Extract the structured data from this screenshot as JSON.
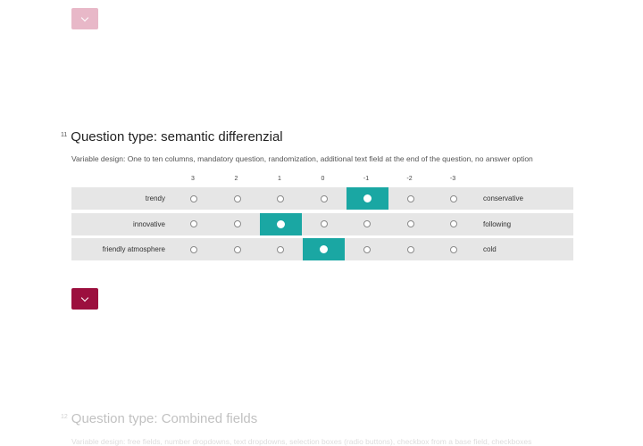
{
  "prev_question": {
    "next_icon": "chevron-down-icon"
  },
  "question": {
    "number": "11",
    "title": "Question type: semantic differenzial",
    "description": "Variable design: One to ten columns, mandatory question, randomization, additional text field at the end of the question, no answer option",
    "scale": [
      "3",
      "2",
      "1",
      "0",
      "-1",
      "-2",
      "-3"
    ],
    "rows": [
      {
        "left": "trendy",
        "right": "conservative",
        "selected": "-1"
      },
      {
        "left": "innovative",
        "right": "following",
        "selected": "1"
      },
      {
        "left": "friendly atmosphere",
        "right": "cold",
        "selected": "0"
      }
    ],
    "next_icon": "chevron-down-icon"
  },
  "next_question": {
    "number": "12",
    "title": "Question type: Combined fields",
    "description": "Variable design: free fields, number dropdowns, text dropdowns, selection boxes (radio buttons), checkbox from a base field, checkboxes"
  },
  "colors": {
    "accent": "#9c0f3e",
    "accent_faded": "#e8b8c8",
    "selected": "#1aa7a3",
    "row_bg": "#e6e6e6"
  }
}
